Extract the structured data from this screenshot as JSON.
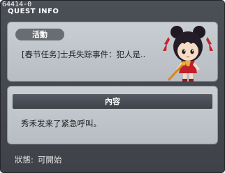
{
  "window": {
    "quest_id": "64414-0",
    "title": "QUEST INFO"
  },
  "quest": {
    "badge": "活動",
    "name": "[春节任务]士兵失踪事件：犯人是.."
  },
  "content": {
    "header": "內容",
    "text": "秀禾发来了紧急呼叫。"
  },
  "status": {
    "label": "狀態:",
    "value": "可開始"
  },
  "colors": {
    "window_bg": "#45484f",
    "panel_bg": "#c3c8cd",
    "header_bg": "#4a4f57",
    "badge_bg": "#686d73"
  },
  "npc_portrait": "npc-girl-portrait"
}
